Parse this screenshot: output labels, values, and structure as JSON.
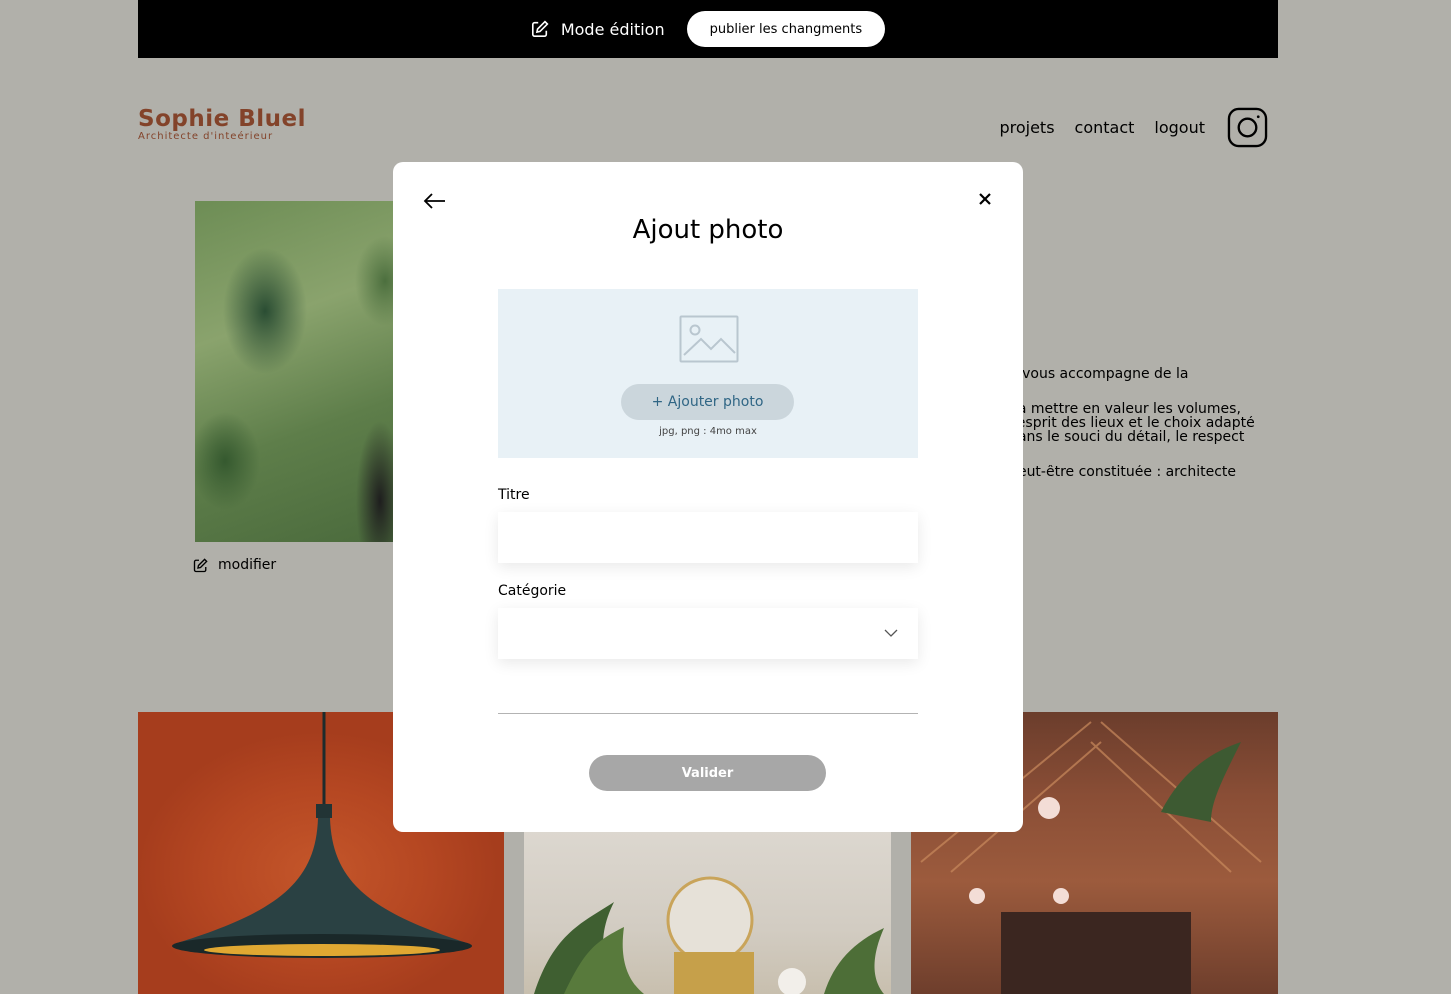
{
  "edit_bar": {
    "mode_label": "Mode édition",
    "publish_label": "publier les changments"
  },
  "header": {
    "logo_name": "Sophie Bluel",
    "logo_subtitle": "Architecte d'inteérieur",
    "nav": [
      "projets",
      "contact",
      "logout"
    ],
    "social_icon": "instagram-icon"
  },
  "intro": {
    "edit_label": "modifier",
    "text_lines": [
      ". Je vous accompagne de la",
      "on à mettre en valeur les volumes,",
      "e l'esprit des lieux et le choix adapté",
      "é dans le souci du détail, le respect",
      "e peut-être constituée : architecte"
    ]
  },
  "modal": {
    "title": "Ajout photo",
    "add_photo_label": "+ Ajouter photo",
    "upload_hint": "jpg, png : 4mo max",
    "title_field_label": "Titre",
    "title_field_value": "",
    "category_field_label": "Catégorie",
    "category_selected": "",
    "submit_label": "Valider"
  },
  "colors": {
    "overlay_bg": "#b1b0aa",
    "brand": "#83432a",
    "upload_zone_bg": "#e8f1f6",
    "add_photo_bg": "#cbd6dc",
    "add_photo_text": "#306685",
    "submit_disabled": "#a7a7a7"
  }
}
